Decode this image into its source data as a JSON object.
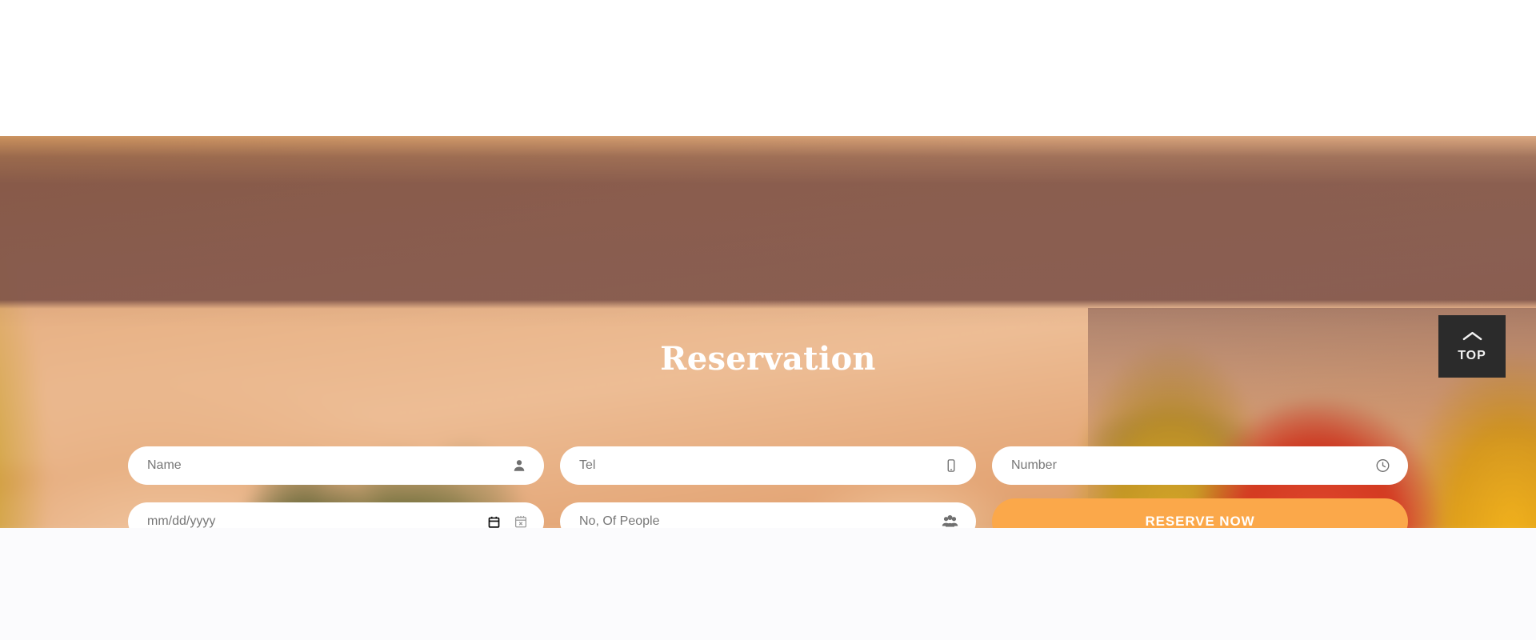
{
  "section": {
    "title": "Reservation"
  },
  "form": {
    "fields": [
      {
        "name": "name",
        "placeholder": "Name",
        "value": "",
        "icon": "user-icon",
        "type": "text"
      },
      {
        "name": "tel",
        "placeholder": "Tel",
        "value": "",
        "icon": "mobile-icon",
        "type": "text"
      },
      {
        "name": "number",
        "placeholder": "Number",
        "value": "",
        "icon": "clock-icon",
        "type": "text"
      },
      {
        "name": "date",
        "placeholder": "mm/dd/yyyy",
        "value": "",
        "icon": "calendar-icon",
        "type": "date"
      },
      {
        "name": "people",
        "placeholder": "No, Of People",
        "value": "",
        "icon": "users-icon",
        "type": "text"
      }
    ],
    "submit_label": "RESERVE NOW"
  },
  "back_to_top": {
    "label": "TOP",
    "icon": "chevron-up-icon"
  },
  "colors": {
    "accent": "#fba84a",
    "overlay": "#744a43",
    "back_to_top_bg": "#2b2b2b",
    "title_text": "#ffffff",
    "placeholder_text": "#777777"
  }
}
